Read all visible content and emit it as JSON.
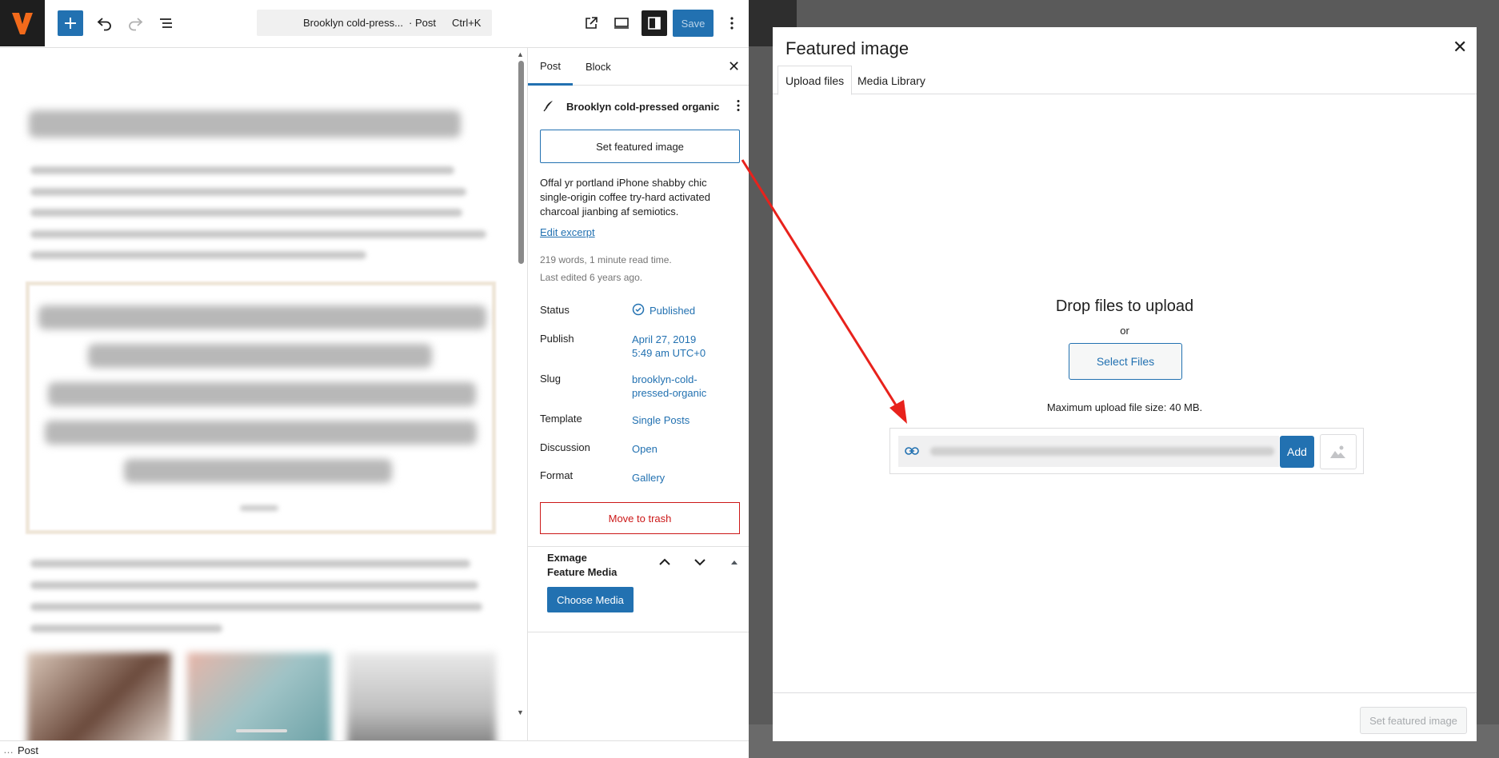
{
  "editor": {
    "command_bar_title": "Brooklyn cold-press...",
    "command_bar_type": "· Post",
    "command_bar_shortcut": "Ctrl+K",
    "save_label": "Save",
    "statusbar_label": "Post"
  },
  "sidebar": {
    "tab_post": "Post",
    "tab_block": "Block",
    "post_title": "Brooklyn cold-pressed organic",
    "set_featured_label": "Set featured image",
    "excerpt": "Offal yr portland iPhone shabby chic single-origin coffee try-hard activated charcoal jianbing af semiotics.",
    "edit_excerpt": "Edit excerpt",
    "word_count": "219 words, 1 minute read time.",
    "last_edited": "Last edited 6 years ago.",
    "rows": [
      {
        "label": "Status",
        "value": "Published"
      },
      {
        "label": "Publish",
        "value": "April 27, 2019",
        "value2": "5:49 am UTC+0"
      },
      {
        "label": "Slug",
        "value": "brooklyn-cold-",
        "value2": "pressed-organic"
      },
      {
        "label": "Template",
        "value": "Single Posts"
      },
      {
        "label": "Discussion",
        "value": "Open"
      },
      {
        "label": "Format",
        "value": "Gallery"
      }
    ],
    "trash_label": "Move to trash",
    "panel_title_1": "Exmage",
    "panel_title_2": "Feature Media",
    "choose_media_label": "Choose Media"
  },
  "modal": {
    "title": "Featured image",
    "tab_upload": "Upload files",
    "tab_library": "Media Library",
    "drop_title": "Drop files to upload",
    "or": "or",
    "select_files": "Select Files",
    "max_size": "Maximum upload file size: 40 MB.",
    "add_label": "Add",
    "footer_button": "Set featured image"
  },
  "colors": {
    "accent": "#2271b1",
    "danger": "#cc1818",
    "annotation_arrow": "#e8221c"
  }
}
